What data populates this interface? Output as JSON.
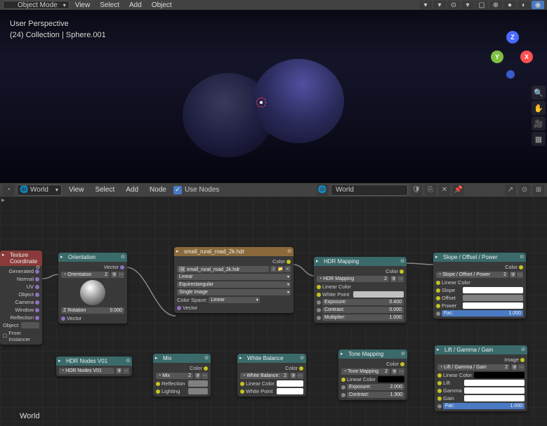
{
  "top_header": {
    "mode": "Object Mode",
    "menus": [
      "View",
      "Select",
      "Add",
      "Object"
    ]
  },
  "viewport": {
    "perspective": "User Perspective",
    "collection": "(24) Collection | Sphere.001",
    "axes": {
      "x": "X",
      "y": "Y",
      "z": "Z"
    }
  },
  "node_header": {
    "world_label": "World",
    "menus": [
      "View",
      "Select",
      "Add",
      "Node"
    ],
    "use_nodes": "Use Nodes",
    "name_field": "World"
  },
  "node_editor_label": "World",
  "nodes": {
    "tex_coord": {
      "title": "Texture Coordinate",
      "outputs": [
        "Generated",
        "Normal",
        "UV",
        "Object",
        "Camera",
        "Window",
        "Reflection"
      ],
      "object_label": "Object:",
      "from_instancer": "From Instancer"
    },
    "orientation": {
      "title": "Orientation",
      "out_vector": "Vector",
      "orient_label": "Orientation",
      "orient_value": "2",
      "zrot_label": "Z Rotation",
      "zrot_value": "0.000",
      "in_vector": "Vector"
    },
    "env_tex": {
      "title": "small_rural_road_2k.hdr",
      "out_color": "Color",
      "image_name": "small_rural_road_2k.hdr",
      "linear": "Linear",
      "equirect": "Equirectangular",
      "single_image": "Single Image",
      "color_space_label": "Color Space:",
      "color_space_value": "Linear",
      "in_vector": "Vector"
    },
    "hdr_mapping": {
      "title": "HDR Mapping",
      "out_color": "Color",
      "label": "HDR Mapping",
      "label_value": "2",
      "linear_color": "Linear Color",
      "white_point": "White Point",
      "exposure_label": "Exposure:",
      "exposure_value": "0.400",
      "contrast_label": "Contrast:",
      "contrast_value": "0.000",
      "multiplier_label": "Multiplier:",
      "multiplier_value": "1.000"
    },
    "sop": {
      "title": "Slope / Offset / Power",
      "out_color": "Color",
      "label": "Slope / Offset / Power",
      "label_value": "2",
      "linear_color": "Linear Color",
      "slope": "Slope",
      "offset": "Offset",
      "power": "Power",
      "fac_label": "Fac:",
      "fac_value": "1.000"
    },
    "hdr_nodes": {
      "title": "HDR Nodes V01",
      "label": "HDR Nodes V01"
    },
    "mix": {
      "title": "Mix",
      "out_color": "Color",
      "label": "Mix",
      "label_value": "2",
      "reflection": "Reflection",
      "lighting": "Lighting"
    },
    "white_balance": {
      "title": "White Balance",
      "out_color": "Color",
      "label": "White Balance:",
      "label_value": "2",
      "linear_color": "Linear Color",
      "white_point": "White Point"
    },
    "tone_mapping": {
      "title": "Tone Mapping",
      "out_color": "Color",
      "label": "Tone Mapping",
      "label_value": "2",
      "linear_color": "Linear Color",
      "exposure_label": "Exposure:",
      "exposure_value": "2.000",
      "contrast_label": "Contrast:",
      "contrast_value": "1.300"
    },
    "lgg": {
      "title": "Lift / Gamma / Gain",
      "out_image": "Image",
      "label": "Lift / Gamma / Gain",
      "label_value": "2",
      "linear_color": "Linear Color",
      "lift": "Lift",
      "gamma": "Gamma",
      "gain": "Gain",
      "fac_label": "Fac:",
      "fac_value": "1.000"
    }
  }
}
